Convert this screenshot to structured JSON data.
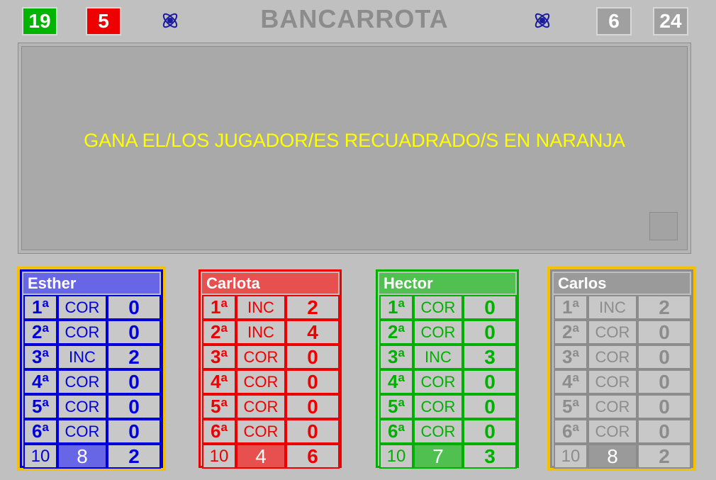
{
  "header": {
    "title": "BANCARROTA",
    "left_scores": [
      "19",
      "5"
    ],
    "right_scores": [
      "6",
      "24"
    ],
    "left_colors": [
      "#00b400",
      "#ee0000"
    ],
    "right_colors": [
      "#a0a0a0",
      "#a0a0a0"
    ]
  },
  "message": "GANA EL/LOS JUGADOR/ES RECUADRADO/S EN NARANJA",
  "players": [
    {
      "name": "Esther",
      "color": "#0000dd",
      "header_bg": "#6666e6",
      "winner": true,
      "rounds": [
        {
          "label": "1ª",
          "status": "COR",
          "score": "0"
        },
        {
          "label": "2ª",
          "status": "COR",
          "score": "0"
        },
        {
          "label": "3ª",
          "status": "INC",
          "score": "2"
        },
        {
          "label": "4ª",
          "status": "COR",
          "score": "0"
        },
        {
          "label": "5ª",
          "status": "COR",
          "score": "0"
        },
        {
          "label": "6ª",
          "status": "COR",
          "score": "0"
        }
      ],
      "footer": {
        "label": "10",
        "value": "8",
        "score": "2"
      }
    },
    {
      "name": "Carlota",
      "color": "#ee0000",
      "header_bg": "#e85050",
      "winner": false,
      "rounds": [
        {
          "label": "1ª",
          "status": "INC",
          "score": "2"
        },
        {
          "label": "2ª",
          "status": "INC",
          "score": "4"
        },
        {
          "label": "3ª",
          "status": "COR",
          "score": "0"
        },
        {
          "label": "4ª",
          "status": "COR",
          "score": "0"
        },
        {
          "label": "5ª",
          "status": "COR",
          "score": "0"
        },
        {
          "label": "6ª",
          "status": "COR",
          "score": "0"
        }
      ],
      "footer": {
        "label": "10",
        "value": "4",
        "score": "6"
      }
    },
    {
      "name": "Hector",
      "color": "#00b000",
      "header_bg": "#50c050",
      "winner": false,
      "rounds": [
        {
          "label": "1ª",
          "status": "COR",
          "score": "0"
        },
        {
          "label": "2ª",
          "status": "COR",
          "score": "0"
        },
        {
          "label": "3ª",
          "status": "INC",
          "score": "3"
        },
        {
          "label": "4ª",
          "status": "COR",
          "score": "0"
        },
        {
          "label": "5ª",
          "status": "COR",
          "score": "0"
        },
        {
          "label": "6ª",
          "status": "COR",
          "score": "0"
        }
      ],
      "footer": {
        "label": "10",
        "value": "7",
        "score": "3"
      }
    },
    {
      "name": "Carlos",
      "color": "#8c8c8c",
      "header_bg": "#9a9a9a",
      "winner": true,
      "rounds": [
        {
          "label": "1ª",
          "status": "INC",
          "score": "2"
        },
        {
          "label": "2ª",
          "status": "COR",
          "score": "0"
        },
        {
          "label": "3ª",
          "status": "COR",
          "score": "0"
        },
        {
          "label": "4ª",
          "status": "COR",
          "score": "0"
        },
        {
          "label": "5ª",
          "status": "COR",
          "score": "0"
        },
        {
          "label": "6ª",
          "status": "COR",
          "score": "0"
        }
      ],
      "footer": {
        "label": "10",
        "value": "8",
        "score": "2"
      }
    }
  ],
  "icons": {
    "left": "atom-icon",
    "right": "atom-icon",
    "panel_button": "square-button"
  }
}
